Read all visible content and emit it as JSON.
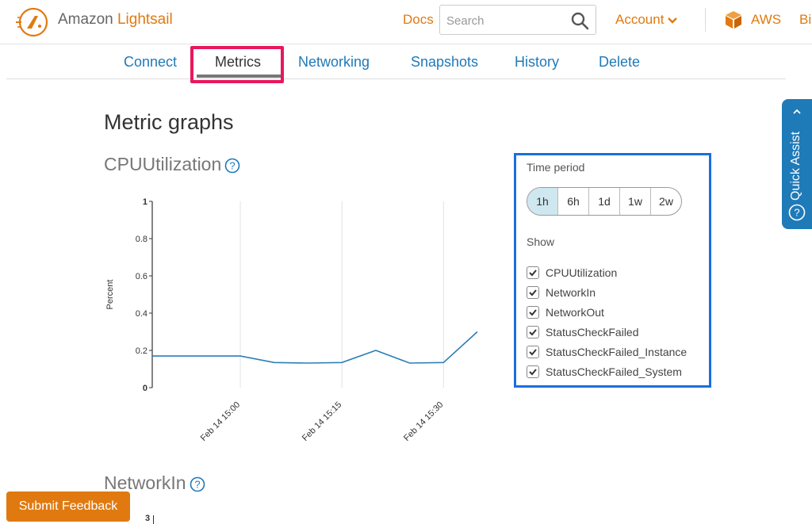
{
  "header": {
    "brand_prefix": "Amazon",
    "brand_name": "Lightsail",
    "docs": "Docs",
    "search_placeholder": "Search",
    "account": "Account",
    "aws": "AWS",
    "billing_truncated": "Bi"
  },
  "tabs": [
    {
      "label": "Connect"
    },
    {
      "label": "Metrics",
      "active": true
    },
    {
      "label": "Networking"
    },
    {
      "label": "Snapshots"
    },
    {
      "label": "History"
    },
    {
      "label": "Delete"
    }
  ],
  "main": {
    "title": "Metric graphs",
    "graph1_title": "CPUUtilization",
    "graph2_title": "NetworkIn",
    "graph2_top_tick": "3"
  },
  "panel": {
    "time_period_label": "Time period",
    "periods": [
      "1h",
      "6h",
      "1d",
      "1w",
      "2w"
    ],
    "selected_period": "1h",
    "show_label": "Show",
    "metrics": [
      {
        "label": "CPUUtilization",
        "checked": true
      },
      {
        "label": "NetworkIn",
        "checked": true
      },
      {
        "label": "NetworkOut",
        "checked": true
      },
      {
        "label": "StatusCheckFailed",
        "checked": true
      },
      {
        "label": "StatusCheckFailed_Instance",
        "checked": true
      },
      {
        "label": "StatusCheckFailed_System",
        "checked": true
      }
    ]
  },
  "quick_assist": "Quick Assist",
  "feedback_button": "Submit Feedback",
  "colors": {
    "brand_orange": "#e07a10",
    "link_blue": "#1f7ab8",
    "highlight_pink": "#e8175d",
    "panel_blue": "#1a6fe0",
    "line_blue": "#2c7fb8"
  },
  "chart_data": {
    "type": "line",
    "title": "CPUUtilization",
    "ylabel": "Percent",
    "xlabel": "",
    "ylim": [
      0,
      1
    ],
    "yticks": [
      "0",
      "0.2",
      "0.4",
      "0.6",
      "0.8",
      "1"
    ],
    "xticks": [
      "Feb 14 15:00",
      "Feb 14 15:15",
      "Feb 14 15:30"
    ],
    "grid": true,
    "series": [
      {
        "x": [
          "Feb 14 14:47",
          "Feb 14 14:55",
          "Feb 14 15:00",
          "Feb 14 15:05",
          "Feb 14 15:10",
          "Feb 14 15:15",
          "Feb 14 15:20",
          "Feb 14 15:25",
          "Feb 14 15:30",
          "Feb 14 15:35"
        ],
        "values": [
          0.17,
          0.17,
          0.17,
          0.135,
          0.132,
          0.135,
          0.2,
          0.132,
          0.135,
          0.3
        ]
      }
    ]
  }
}
